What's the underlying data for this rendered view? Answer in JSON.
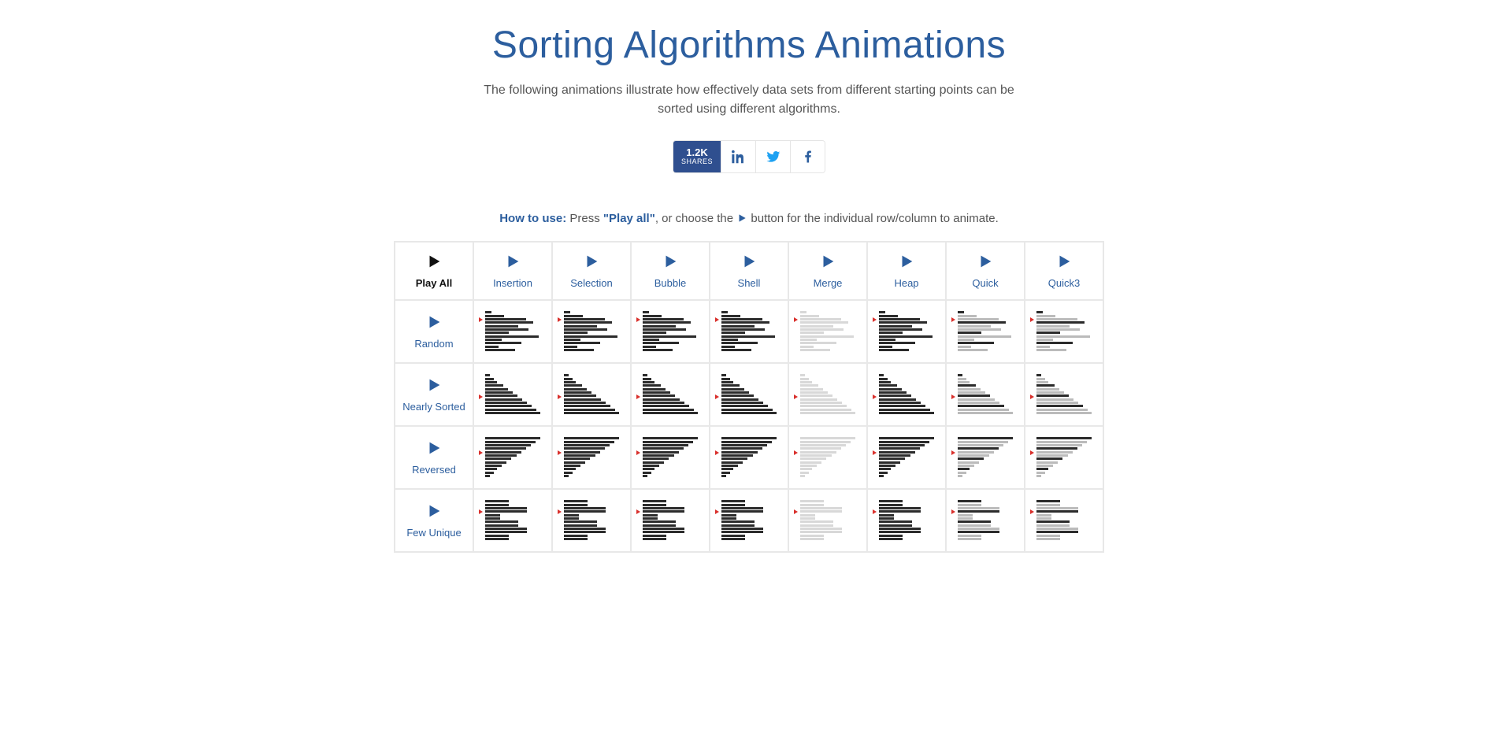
{
  "title": "Sorting Algorithms Animations",
  "subtitle": "The following animations illustrate how effectively data sets from different starting points can be sorted using different algorithms.",
  "share": {
    "count": "1.2K",
    "count_label": "SHARES"
  },
  "howto": {
    "label": "How to use:",
    "text_before": " Press ",
    "play_all_quoted": "\"Play all\"",
    "text_mid": ", or choose the ",
    "text_after": " button for the individual row/column to animate."
  },
  "columns": [
    {
      "id": "play-all",
      "label": "Play All",
      "color": "black"
    },
    {
      "id": "insertion",
      "label": "Insertion",
      "color": "blue"
    },
    {
      "id": "selection",
      "label": "Selection",
      "color": "blue"
    },
    {
      "id": "bubble",
      "label": "Bubble",
      "color": "blue"
    },
    {
      "id": "shell",
      "label": "Shell",
      "color": "blue"
    },
    {
      "id": "merge",
      "label": "Merge",
      "color": "blue"
    },
    {
      "id": "heap",
      "label": "Heap",
      "color": "blue"
    },
    {
      "id": "quick",
      "label": "Quick",
      "color": "blue"
    },
    {
      "id": "quick3",
      "label": "Quick3",
      "color": "blue"
    }
  ],
  "rows": [
    {
      "id": "random",
      "label": "Random"
    },
    {
      "id": "nearly-sorted",
      "label": "Nearly Sorted"
    },
    {
      "id": "reversed",
      "label": "Reversed"
    },
    {
      "id": "few-unique",
      "label": "Few Unique"
    }
  ],
  "thumb_profiles": {
    "random": {
      "bars": [
        10,
        32,
        68,
        80,
        55,
        72,
        40,
        90,
        28,
        60,
        22,
        50
      ],
      "shades": [
        "d",
        "d",
        "d",
        "d",
        "d",
        "d",
        "d",
        "d",
        "d",
        "d",
        "d",
        "d"
      ],
      "marker": 2
    },
    "nearly-sorted": {
      "bars": [
        8,
        14,
        20,
        30,
        38,
        46,
        54,
        62,
        70,
        78,
        85,
        92
      ],
      "shades": [
        "d",
        "d",
        "d",
        "d",
        "d",
        "d",
        "d",
        "d",
        "d",
        "d",
        "d",
        "d"
      ],
      "marker": 6
    },
    "reversed": {
      "bars": [
        92,
        84,
        76,
        68,
        60,
        52,
        44,
        36,
        28,
        20,
        14,
        8
      ],
      "shades": [
        "d",
        "d",
        "d",
        "d",
        "d",
        "d",
        "d",
        "d",
        "d",
        "d",
        "d",
        "d"
      ],
      "marker": 4
    },
    "few-unique": {
      "bars": [
        40,
        40,
        70,
        70,
        25,
        25,
        55,
        55,
        70,
        70,
        40,
        40
      ],
      "shades": [
        "d",
        "d",
        "d",
        "d",
        "d",
        "d",
        "d",
        "d",
        "d",
        "d",
        "d",
        "d"
      ],
      "marker": 3
    }
  },
  "col_shade_overrides": {
    "merge": "light",
    "quick": "mixed",
    "quick3": "mixed"
  }
}
